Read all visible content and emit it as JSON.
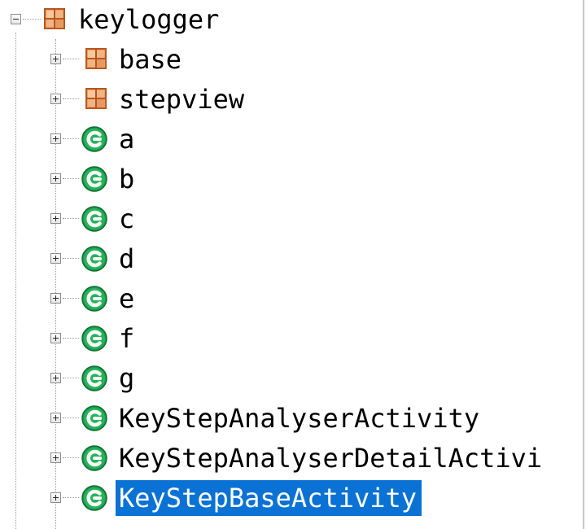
{
  "tree": {
    "root": {
      "label": "keylogger",
      "icon": "package-icon",
      "expanded": true
    },
    "children": [
      {
        "label": "base",
        "icon": "package-icon",
        "expanded": false
      },
      {
        "label": "stepview",
        "icon": "package-icon",
        "expanded": false
      },
      {
        "label": "a",
        "icon": "class-icon",
        "expanded": false
      },
      {
        "label": "b",
        "icon": "class-icon",
        "expanded": false
      },
      {
        "label": "c",
        "icon": "class-icon",
        "expanded": false
      },
      {
        "label": "d",
        "icon": "class-icon",
        "expanded": false
      },
      {
        "label": "e",
        "icon": "class-icon",
        "expanded": false
      },
      {
        "label": "f",
        "icon": "class-icon",
        "expanded": false
      },
      {
        "label": "g",
        "icon": "class-icon",
        "expanded": false
      },
      {
        "label": "KeyStepAnalyserActivity",
        "icon": "class-icon",
        "expanded": false
      },
      {
        "label": "KeyStepAnalyserDetailActivi",
        "icon": "class-icon",
        "expanded": false
      },
      {
        "label": "KeyStepBaseActivity",
        "icon": "class-icon",
        "expanded": false,
        "selected": true
      }
    ]
  },
  "colors": {
    "selection": "#0a72d4",
    "class_icon": "#1a9a4a",
    "package_icon": "#c8622a"
  }
}
